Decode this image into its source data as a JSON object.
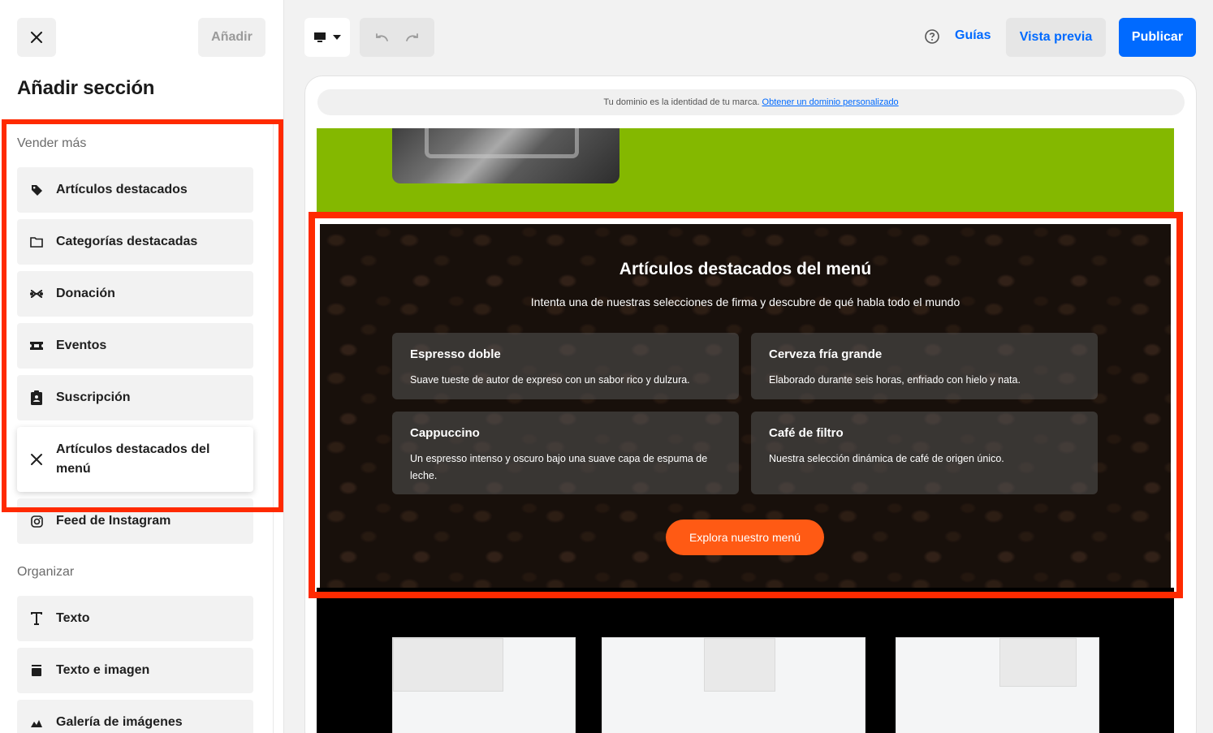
{
  "panel": {
    "add_label": "Añadir",
    "title": "Añadir sección",
    "group_sell": "Vender más",
    "group_organize": "Organizar",
    "sell_items": [
      {
        "label": "Artículos destacados",
        "icon": "tag-icon"
      },
      {
        "label": "Categorías destacadas",
        "icon": "folder-icon"
      },
      {
        "label": "Donación",
        "icon": "donation-icon"
      },
      {
        "label": "Eventos",
        "icon": "ticket-icon"
      },
      {
        "label": "Suscripción",
        "icon": "subscription-icon"
      },
      {
        "label": "Artículos destacados del menú",
        "icon": "utensils-icon"
      },
      {
        "label": "Feed de Instagram",
        "icon": "instagram-icon"
      }
    ],
    "organize_items": [
      {
        "label": "Texto",
        "icon": "text-icon"
      },
      {
        "label": "Texto e imagen",
        "icon": "text-image-icon"
      },
      {
        "label": "Galería de imágenes",
        "icon": "gallery-icon"
      }
    ]
  },
  "toolbar": {
    "guides_label": "Guías",
    "preview_label": "Vista previa",
    "publish_label": "Publicar"
  },
  "canvas": {
    "domain_text": "Tu dominio es la identidad de tu marca.",
    "domain_link": "Obtener un dominio personalizado"
  },
  "menu_section": {
    "title": "Artículos destacados del menú",
    "subtitle": "Intenta una de nuestras selecciones de firma y descubre de qué habla todo el mundo",
    "cards": [
      {
        "name": "Espresso doble",
        "desc": "Suave tueste de autor de expreso con un sabor rico y dulzura."
      },
      {
        "name": "Cerveza fría grande",
        "desc": "Elaborado durante seis horas, enfriado con hielo y nata."
      },
      {
        "name": "Cappuccino",
        "desc": "Un espresso intenso y oscuro bajo una suave capa de espuma de leche."
      },
      {
        "name": "Café de filtro",
        "desc": "Nuestra selección dinámica de café de origen único."
      }
    ],
    "cta_label": "Explora nuestro menú"
  },
  "colors": {
    "accent_blue": "#006aff",
    "highlight_red": "#ff2a00",
    "cta_orange": "#ff5a14",
    "green_band": "#84b800"
  }
}
